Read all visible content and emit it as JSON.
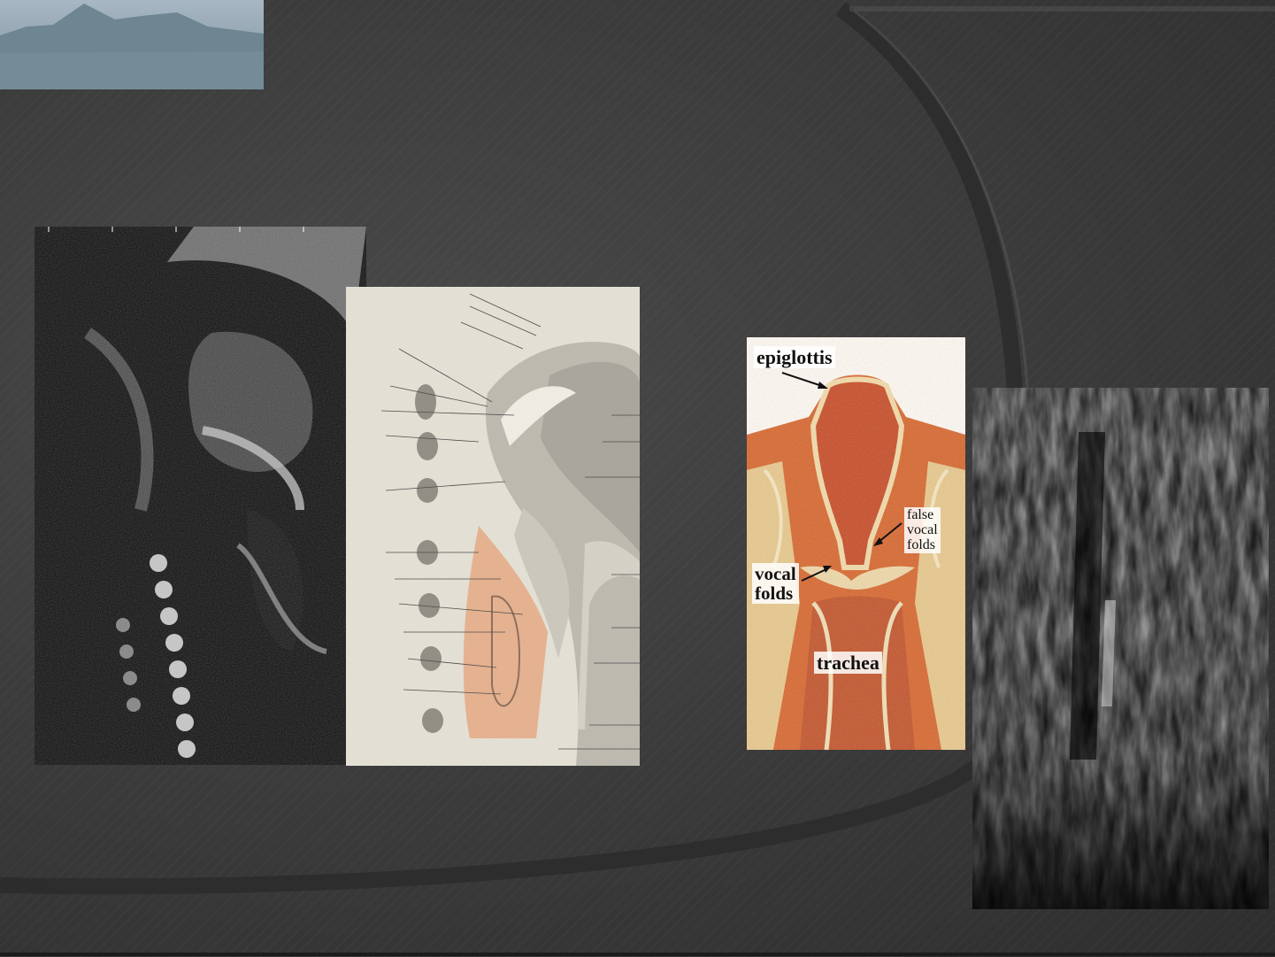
{
  "larynx_labels": {
    "epiglottis": "epiglottis",
    "false_vocal_folds": [
      "false",
      "vocal",
      "folds"
    ],
    "vocal_folds": [
      "vocal",
      "folds"
    ],
    "trachea": "trachea"
  },
  "colors": {
    "background": "#3a3a3a",
    "logo_sky": "#a7b7c3",
    "logo_mountain": "#6e8592",
    "tissue_orange": "#d9682f",
    "highlight_overlay": "#e8a074"
  }
}
